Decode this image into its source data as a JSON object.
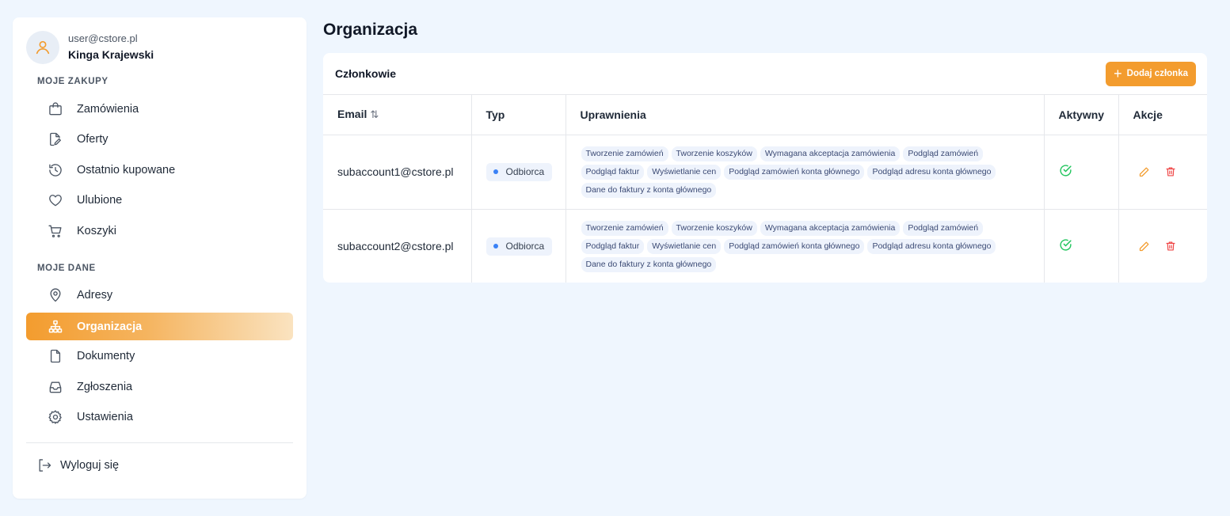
{
  "user": {
    "email": "user@cstore.pl",
    "name": "Kinga Krajewski"
  },
  "sidebar": {
    "section_purchases": "MOJE ZAKUPY",
    "section_data": "MOJE DANE",
    "items": [
      {
        "label": "Zamówienia",
        "icon": "shopping-bag-icon"
      },
      {
        "label": "Oferty",
        "icon": "file-pen-icon"
      },
      {
        "label": "Ostatnio kupowane",
        "icon": "history-icon"
      },
      {
        "label": "Ulubione",
        "icon": "heart-icon"
      },
      {
        "label": "Koszyki",
        "icon": "cart-icon"
      },
      {
        "label": "Adresy",
        "icon": "map-pin-icon"
      },
      {
        "label": "Organizacja",
        "icon": "org-chart-icon",
        "active": true
      },
      {
        "label": "Dokumenty",
        "icon": "file-icon"
      },
      {
        "label": "Zgłoszenia",
        "icon": "inbox-icon"
      },
      {
        "label": "Ustawienia",
        "icon": "gear-icon"
      }
    ],
    "logout": "Wyloguj się"
  },
  "page": {
    "title": "Organizacja"
  },
  "members": {
    "title": "Członkowie",
    "add_button": "Dodaj członka",
    "columns": [
      "Email",
      "Typ",
      "Uprawnienia",
      "Aktywny",
      "Akcje"
    ],
    "rows": [
      {
        "email": "subaccount1@cstore.pl",
        "type": "Odbiorca",
        "permissions": [
          "Tworzenie zamówień",
          "Tworzenie koszyków",
          "Wymagana akceptacja zamówienia",
          "Podgląd zamówień",
          "Podgląd faktur",
          "Wyświetlanie cen",
          "Podgląd zamówień konta głównego",
          "Podgląd adresu konta głównego",
          "Dane do faktury z konta głównego"
        ]
      },
      {
        "email": "subaccount2@cstore.pl",
        "type": "Odbiorca",
        "permissions": [
          "Tworzenie zamówień",
          "Tworzenie koszyków",
          "Wymagana akceptacja zamówienia",
          "Podgląd zamówień",
          "Podgląd faktur",
          "Wyświetlanie cen",
          "Podgląd zamówień konta głównego",
          "Podgląd adresu konta głównego",
          "Dane do faktury z konta głównego"
        ]
      }
    ]
  },
  "colors": {
    "accent": "#f39c2e",
    "success": "#22c55e",
    "danger": "#ef4444",
    "background": "#eff6fe"
  }
}
